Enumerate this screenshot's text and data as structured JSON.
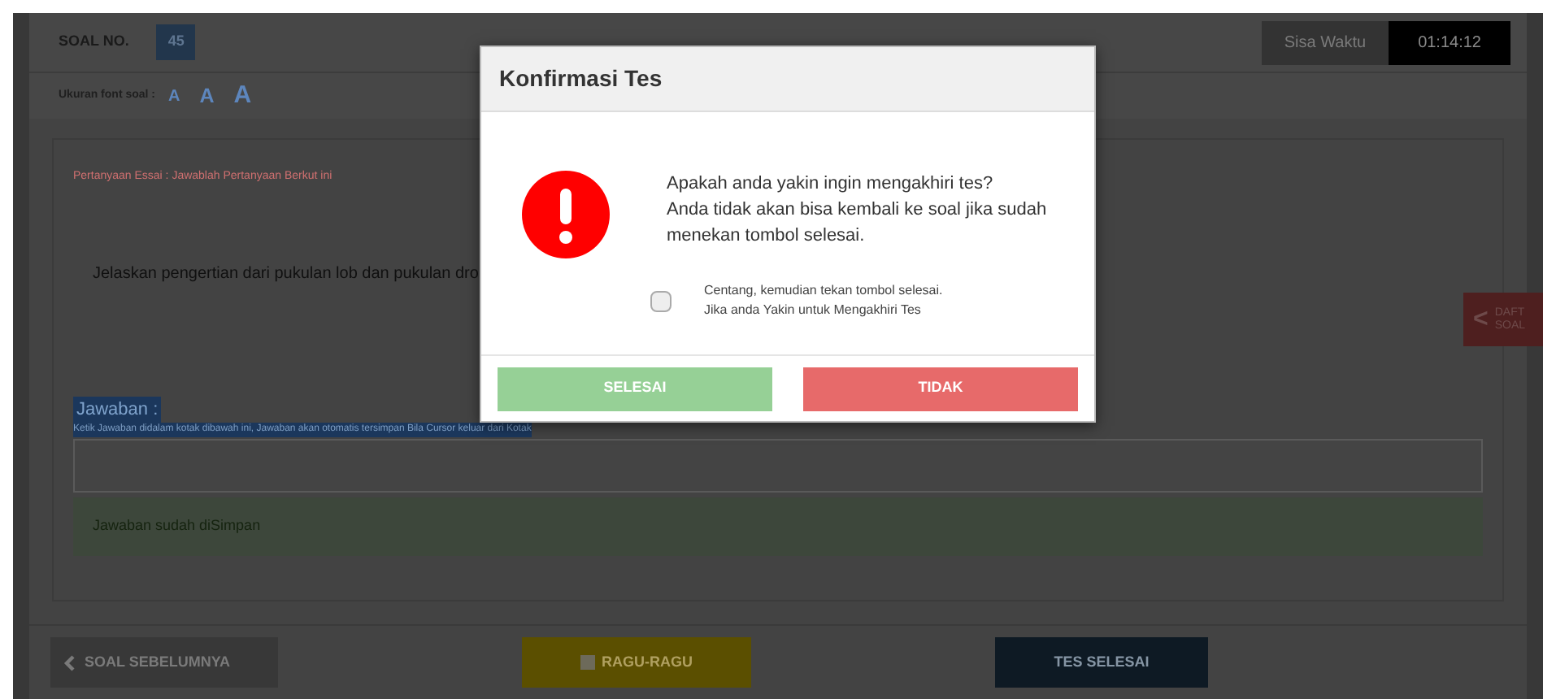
{
  "header": {
    "question_label": "SOAL NO.",
    "question_number": "45",
    "timer_label": "Sisa Waktu",
    "timer_value": "01:14:12"
  },
  "font_size": {
    "label": "Ukuran font soal :",
    "options": [
      "A",
      "A",
      "A"
    ]
  },
  "question": {
    "instruction": "Pertanyaan Essai : Jawablah Pertanyaan Berkut ini",
    "text": "Jelaskan pengertian dari pukulan lob dan pukulan dro"
  },
  "answer": {
    "label": "Jawaban :",
    "hint": "Ketik Jawaban didalam kotak dibawah ini, Jawaban akan otomatis tersimpan Bila Cursor keluar dari Kotak",
    "status": "Jawaban sudah diSimpan"
  },
  "side_tab": {
    "icon": "<",
    "lines": [
      "DAFT",
      "SOAL"
    ]
  },
  "nav": {
    "prev": "SOAL SEBELUMNYA",
    "doubt": {
      "label": "RAGU-RAGU",
      "checked": false
    },
    "finish": "TES SELESAI"
  },
  "modal": {
    "title": "Konfirmasi Tes",
    "message": [
      "Apakah anda yakin ingin mengakhiri tes?",
      "Anda tidak akan bisa kembali ke soal jika sudah",
      "menekan tombol selesai."
    ],
    "confirm": {
      "checked": false,
      "lines": [
        "Centang, kemudian tekan tombol selesai.",
        "Jika anda Yakin untuk Mengakhiri Tes"
      ]
    },
    "buttons": [
      {
        "label": "SELESAI",
        "kind": "confirm"
      },
      {
        "label": "TIDAK",
        "kind": "cancel"
      }
    ]
  }
}
